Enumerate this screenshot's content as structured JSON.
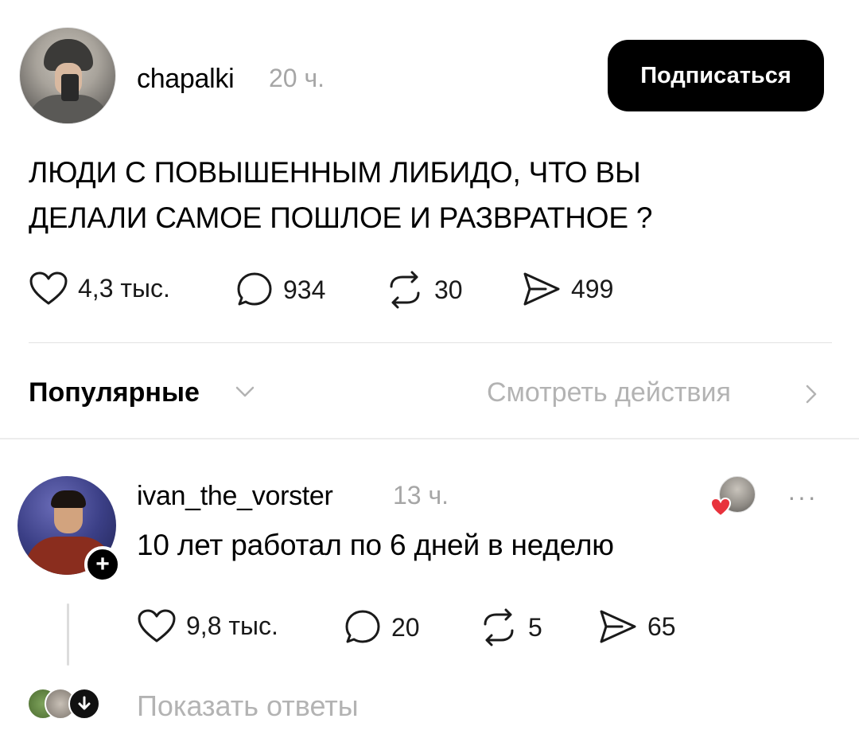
{
  "post": {
    "username": "chapalki",
    "time": "20 ч.",
    "follow_label": "Подписаться",
    "text_line1": "ЛЮДИ С ПОВЫШЕННЫМ ЛИБИДО, ЧТО ВЫ",
    "text_line2": "ДЕЛАЛИ САМОЕ ПОШЛОЕ И РАЗВРАТНОЕ ?",
    "likes": "4,3 тыс.",
    "comments": "934",
    "reposts": "30",
    "shares": "499"
  },
  "sort": {
    "label": "Популярные",
    "view_actions": "Смотреть действия"
  },
  "reply": {
    "username": "ivan_the_vorster",
    "time": "13 ч.",
    "text": "10 лет работал по 6 дней в неделю",
    "likes": "9,8 тыс.",
    "comments": "20",
    "reposts": "5",
    "shares": "65",
    "more": "···"
  },
  "show_replies": "Показать ответы",
  "icons": {
    "like": "heart-icon",
    "comment": "comment-bubble-icon",
    "repost": "repost-icon",
    "share": "send-icon",
    "chevron_down": "chevron-down-icon",
    "chevron_right": "chevron-right-icon",
    "plus": "plus-icon",
    "arrow_down": "arrow-down-icon"
  },
  "colors": {
    "text": "#000000",
    "muted": "#a6a6a6",
    "button_bg": "#000000",
    "heart_red": "#e8323c"
  }
}
